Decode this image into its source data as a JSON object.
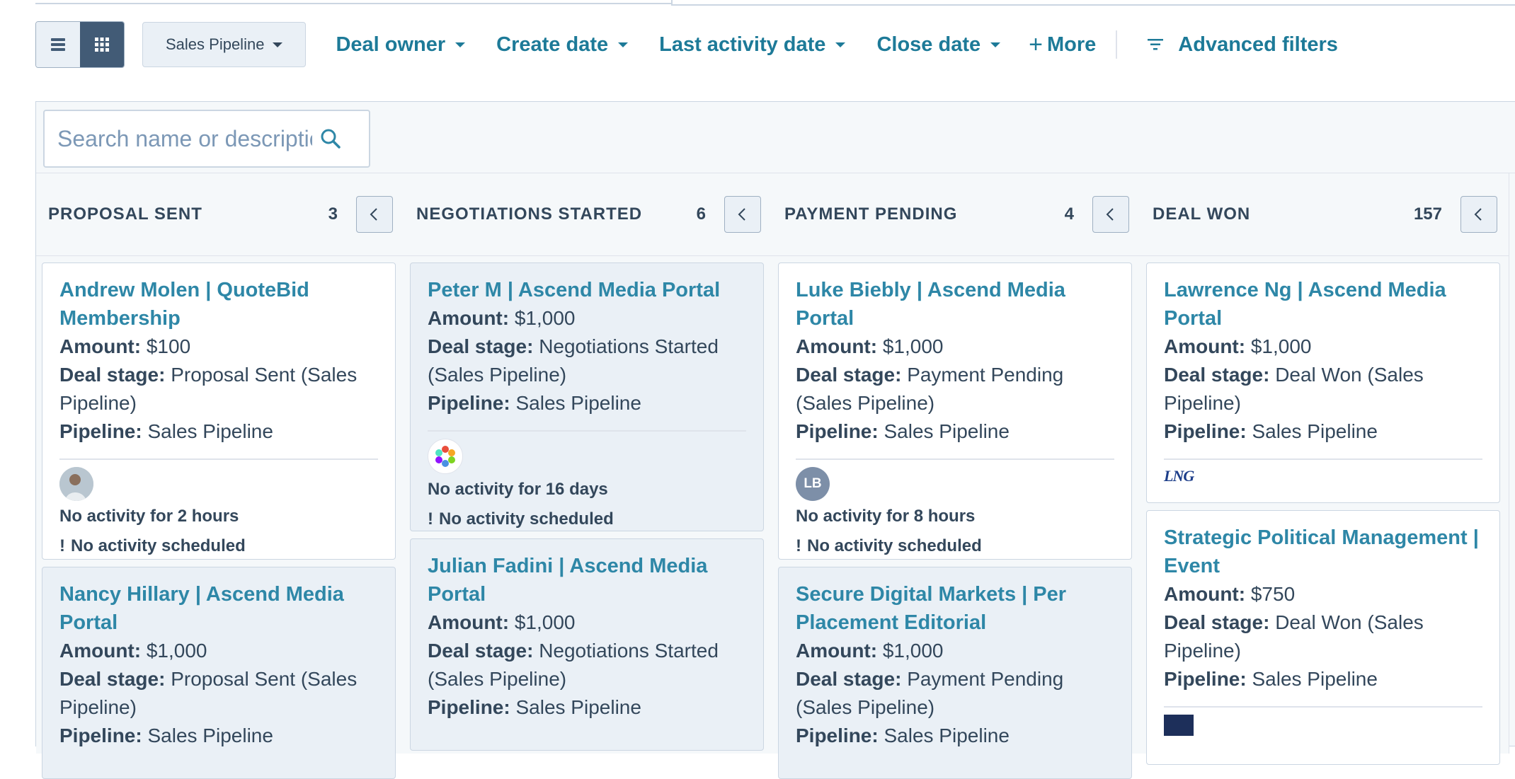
{
  "toolbar": {
    "pipeline_label": "Sales Pipeline",
    "filters": [
      "Deal owner",
      "Create date",
      "Last activity date",
      "Close date"
    ],
    "more_label": "More",
    "advanced_label": "Advanced filters"
  },
  "search": {
    "placeholder": "Search name or description"
  },
  "accent": "#2e87a7",
  "columns": [
    {
      "title": "PROPOSAL SENT",
      "count": "3",
      "cards": [
        {
          "title": "Andrew Molen | QuoteBid Membership",
          "amount": "$100",
          "stage": "Proposal Sent (Sales Pipeline)",
          "pipeline": "Sales Pipeline",
          "activity": "No activity for 2 hours",
          "scheduled": "No activity scheduled"
        },
        {
          "title": "Nancy Hillary | Ascend Media Portal",
          "amount": "$1,000",
          "stage": "Proposal Sent (Sales Pipeline)",
          "pipeline": "Sales Pipeline"
        }
      ]
    },
    {
      "title": "NEGOTIATIONS STARTED",
      "count": "6",
      "cards": [
        {
          "title": "Peter M | Ascend Media Portal",
          "amount": "$1,000",
          "stage": "Negotiations Started (Sales Pipeline)",
          "pipeline": "Sales Pipeline",
          "activity": "No activity for 16 days",
          "scheduled": "No activity scheduled"
        },
        {
          "title": "Julian Fadini | Ascend Media Portal",
          "amount": "$1,000",
          "stage": "Negotiations Started (Sales Pipeline)",
          "pipeline": "Sales Pipeline"
        }
      ]
    },
    {
      "title": "PAYMENT PENDING",
      "count": "4",
      "cards": [
        {
          "title": "Luke Biebly | Ascend Media Portal",
          "amount": "$1,000",
          "stage": "Payment Pending (Sales Pipeline)",
          "pipeline": "Sales Pipeline",
          "avatar_initials": "LB",
          "activity": "No activity for 8 hours",
          "scheduled": "No activity scheduled"
        },
        {
          "title": "Secure Digital Markets | Per Placement Editorial",
          "amount": "$1,000",
          "stage": "Payment Pending (Sales Pipeline)",
          "pipeline": "Sales Pipeline"
        }
      ]
    },
    {
      "title": "DEAL WON",
      "count": "157",
      "cards": [
        {
          "title": "Lawrence Ng | Ascend Media Portal",
          "amount": "$1,000",
          "stage": "Deal Won (Sales Pipeline)",
          "pipeline": "Sales Pipeline",
          "logo": "LNG"
        },
        {
          "title": "Strategic Political Management | Event",
          "amount": "$750",
          "stage": "Deal Won (Sales Pipeline)",
          "pipeline": "Sales Pipeline"
        }
      ]
    }
  ],
  "labels": {
    "amount": "Amount:",
    "stage": "Deal stage:",
    "pipeline": "Pipeline:"
  }
}
